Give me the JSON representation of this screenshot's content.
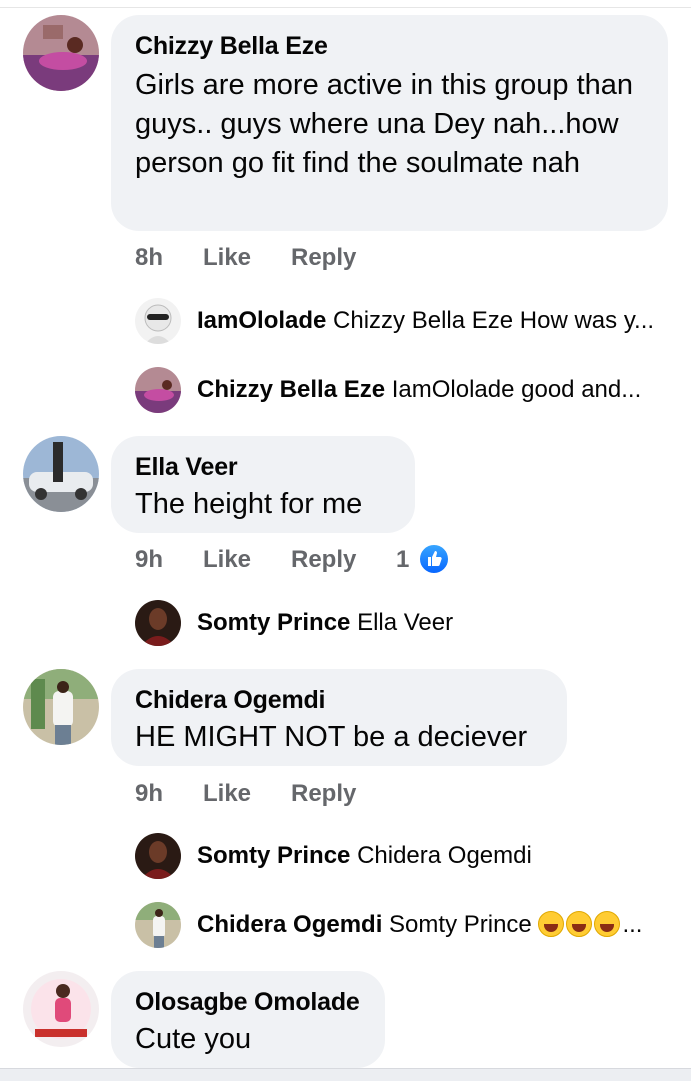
{
  "comments": [
    {
      "name": "Chizzy Bella Eze",
      "text": "Girls are more active in this group than guys.. guys where una Dey nah...how person go fit find the soulmate nah",
      "time": "8h",
      "like": "Like",
      "reply": "Reply",
      "replies": [
        {
          "name": "IamOlolade",
          "text": "Chizzy Bella Eze How was y..."
        },
        {
          "name": "Chizzy Bella Eze",
          "text": "IamOlolade good and..."
        }
      ]
    },
    {
      "name": "Ella Veer",
      "text": "The height for me",
      "time": "9h",
      "like": "Like",
      "reply": "Reply",
      "reaction_count": "1",
      "replies": [
        {
          "name": "Somty Prince",
          "text": "Ella Veer"
        }
      ]
    },
    {
      "name": "Chidera Ogemdi",
      "text": "HE MIGHT NOT be a deciever",
      "time": "9h",
      "like": "Like",
      "reply": "Reply",
      "replies": [
        {
          "name": "Somty Prince",
          "text": "Chidera Ogemdi"
        },
        {
          "name": "Chidera Ogemdi",
          "text": "Somty Prince",
          "suffix": "..."
        }
      ]
    },
    {
      "name": "Olosagbe Omolade",
      "text": "Cute you"
    }
  ],
  "colors": {
    "bubble": "#f0f2f5",
    "meta": "#65676b",
    "like_blue": "#0866ff"
  },
  "icons": [
    "avatar-photo",
    "like-thumb-icon",
    "laughing-emoji-icon"
  ]
}
